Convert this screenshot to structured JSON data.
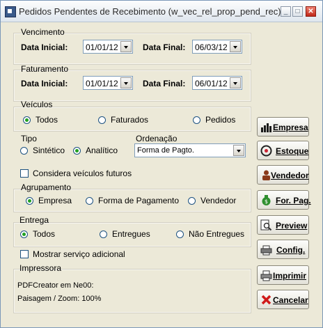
{
  "window": {
    "title": "Pedidos Pendentes de Recebimento (w_vec_rel_prop_pend_rec)",
    "title_bar_buttons": [
      "minimize",
      "maximize",
      "close"
    ]
  },
  "vencimento": {
    "label": "Vencimento",
    "data_inicial_label": "Data Inicial:",
    "data_inicial_value": "01/01/12",
    "data_final_label": "Data Final:",
    "data_final_value": "06/03/12"
  },
  "faturamento": {
    "label": "Faturamento",
    "data_inicial_label": "Data Inicial:",
    "data_inicial_value": "01/01/12",
    "data_final_label": "Data Final:",
    "data_final_value": "06/01/12"
  },
  "veiculos": {
    "label": "Veículos",
    "options": [
      "Todos",
      "Faturados",
      "Pedidos"
    ],
    "selected": "Todos"
  },
  "tipo": {
    "label": "Tipo",
    "options": [
      "Sintético",
      "Analítico"
    ],
    "selected": "Analítico"
  },
  "ordenacao": {
    "label": "Ordenação",
    "value": "Forma de Pagto."
  },
  "futuros": {
    "label": "Considera veículos futuros",
    "checked": false
  },
  "agrupamento": {
    "label": "Agrupamento",
    "options": [
      "Empresa",
      "Forma de Pagamento",
      "Vendedor"
    ],
    "selected": "Empresa"
  },
  "entrega": {
    "label": "Entrega",
    "options": [
      "Todos",
      "Entregues",
      "Não Entregues"
    ],
    "selected": "Todos"
  },
  "servico": {
    "label": "Mostrar serviço adicional",
    "checked": false
  },
  "impressora": {
    "label": "Impressora",
    "printer": "PDFCreator em Ne00:",
    "layout": "Paisagem / Zoom: 100%"
  },
  "buttons": {
    "empresa": "Empresa",
    "estoque": "Estoque",
    "vendedor": "Vendedor",
    "forpag": "For. Pag.",
    "preview": "Preview",
    "config": "Config.",
    "imprimir": "Imprimir",
    "cancelar": "Cancelar"
  },
  "colors": {
    "window_bg": "#ece9d8",
    "radio_dot": "#21a121",
    "close_button": "#c0281a"
  }
}
